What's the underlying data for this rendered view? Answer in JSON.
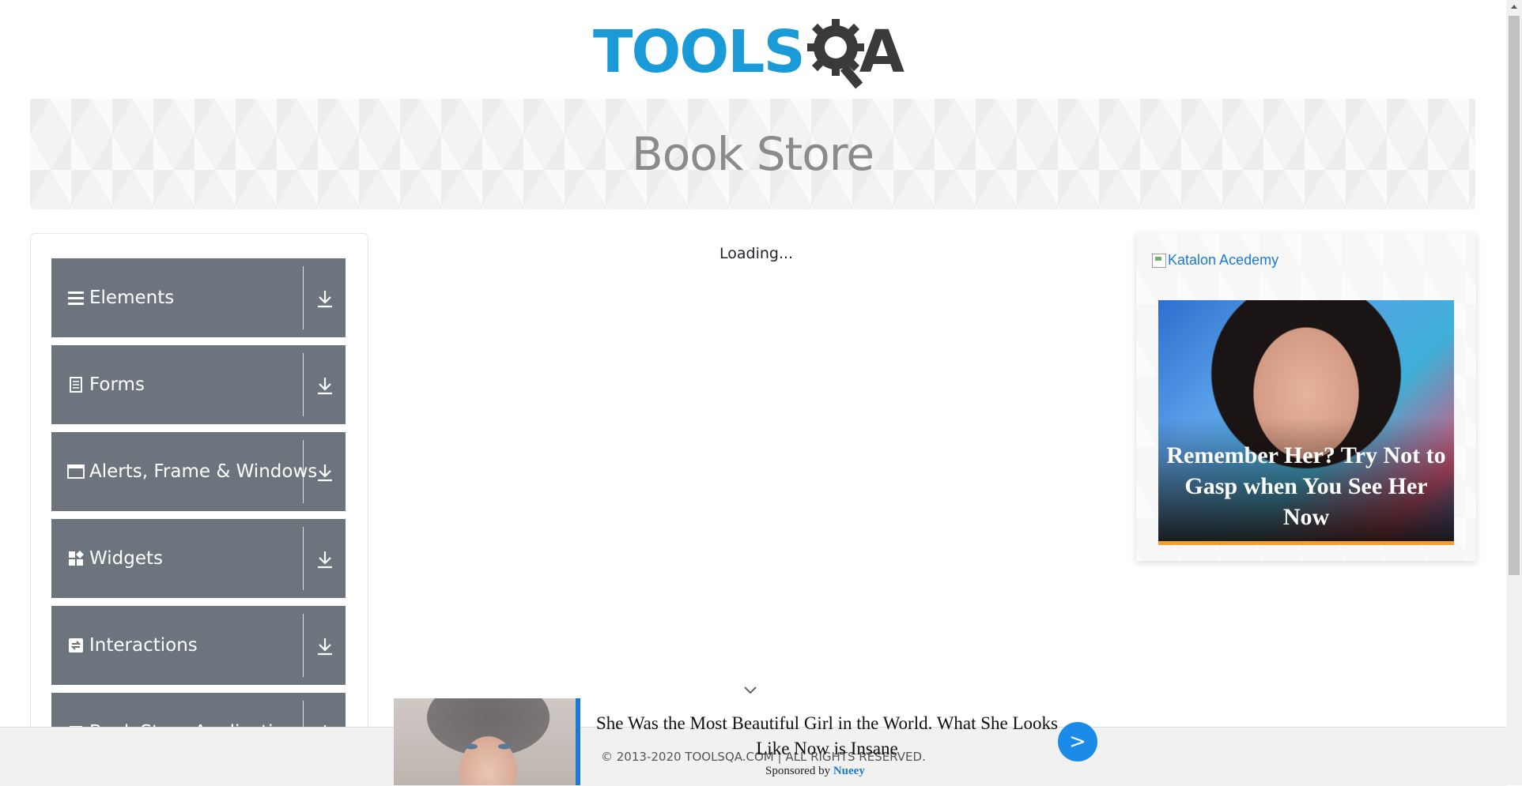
{
  "header": {
    "logo_text_primary": "TOOLS",
    "logo_text_secondary": "A"
  },
  "banner": {
    "title": "Book Store"
  },
  "sidebar": {
    "groups": [
      {
        "label": "Elements",
        "icon": "menu-icon"
      },
      {
        "label": "Forms",
        "icon": "document-icon"
      },
      {
        "label": "Alerts, Frame & Windows",
        "icon": "window-icon"
      },
      {
        "label": "Widgets",
        "icon": "widgets-icon"
      },
      {
        "label": "Interactions",
        "icon": "interactions-icon"
      },
      {
        "label": "Book Store Application",
        "icon": "book-icon"
      }
    ]
  },
  "main": {
    "loading_text": "Loading..."
  },
  "right_ad": {
    "alt_text": "Katalon Acedemy",
    "caption": "Remember Her? Try Not to Gasp when You See Her Now"
  },
  "footer": {
    "copyright": "© 2013-2020 TOOLSQA.COM | ALL RIGHTS RESERVED."
  },
  "bottom_ad": {
    "headline": "She Was the Most Beautiful Girl in the World. What She Looks Like Now is Insane",
    "sponsored_prefix": "Sponsored by",
    "sponsor_name": "Nueey",
    "go_label": ">"
  },
  "colors": {
    "accent": "#1a9bd7",
    "menu_bg": "#6c757d",
    "link": "#1a7bd6"
  }
}
